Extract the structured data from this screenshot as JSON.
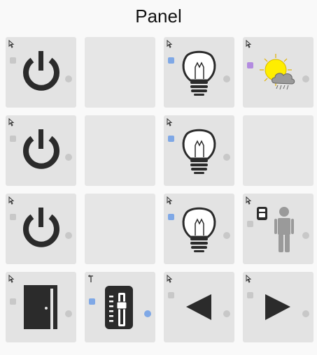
{
  "title": "Panel",
  "colors": {
    "tile_bg": "#e3e3e3",
    "indicator_grey": "#c8c8c8",
    "indicator_blue": "#7fa8e6",
    "indicator_purple": "#b38be0",
    "icon_dark": "#2b2b2b"
  },
  "tiles": [
    {
      "icon": "power-icon",
      "corner": "cursor-icon",
      "square": "grey",
      "dot": "grey"
    },
    {
      "icon": "empty"
    },
    {
      "icon": "lightbulb-icon",
      "corner": "cursor-icon",
      "square": "blue",
      "dot": "grey"
    },
    {
      "icon": "weather-sun-rain-icon",
      "corner": "cursor-icon",
      "square": "purple",
      "dot": "grey"
    },
    {
      "icon": "power-icon",
      "corner": "cursor-icon",
      "square": "grey",
      "dot": "grey"
    },
    {
      "icon": "empty"
    },
    {
      "icon": "lightbulb-icon",
      "corner": "cursor-icon",
      "square": "blue",
      "dot": "grey"
    },
    {
      "icon": "empty"
    },
    {
      "icon": "power-icon",
      "corner": "cursor-icon",
      "square": "grey",
      "dot": "grey"
    },
    {
      "icon": "empty"
    },
    {
      "icon": "lightbulb-icon",
      "corner": "cursor-icon",
      "square": "blue",
      "dot": "grey"
    },
    {
      "icon": "person-presence-icon",
      "corner": "cursor-icon",
      "square": "grey",
      "dot": "grey"
    },
    {
      "icon": "door-icon",
      "corner": "cursor-icon",
      "square": "grey",
      "dot": "grey"
    },
    {
      "icon": "slider-dimmer-icon",
      "corner": "pin-icon",
      "square": "blue",
      "dot": "blue"
    },
    {
      "icon": "arrow-left-icon",
      "corner": "cursor-icon",
      "square": "grey",
      "dot": "grey"
    },
    {
      "icon": "arrow-right-icon",
      "corner": "cursor-icon",
      "square": "grey",
      "dot": "grey"
    }
  ]
}
